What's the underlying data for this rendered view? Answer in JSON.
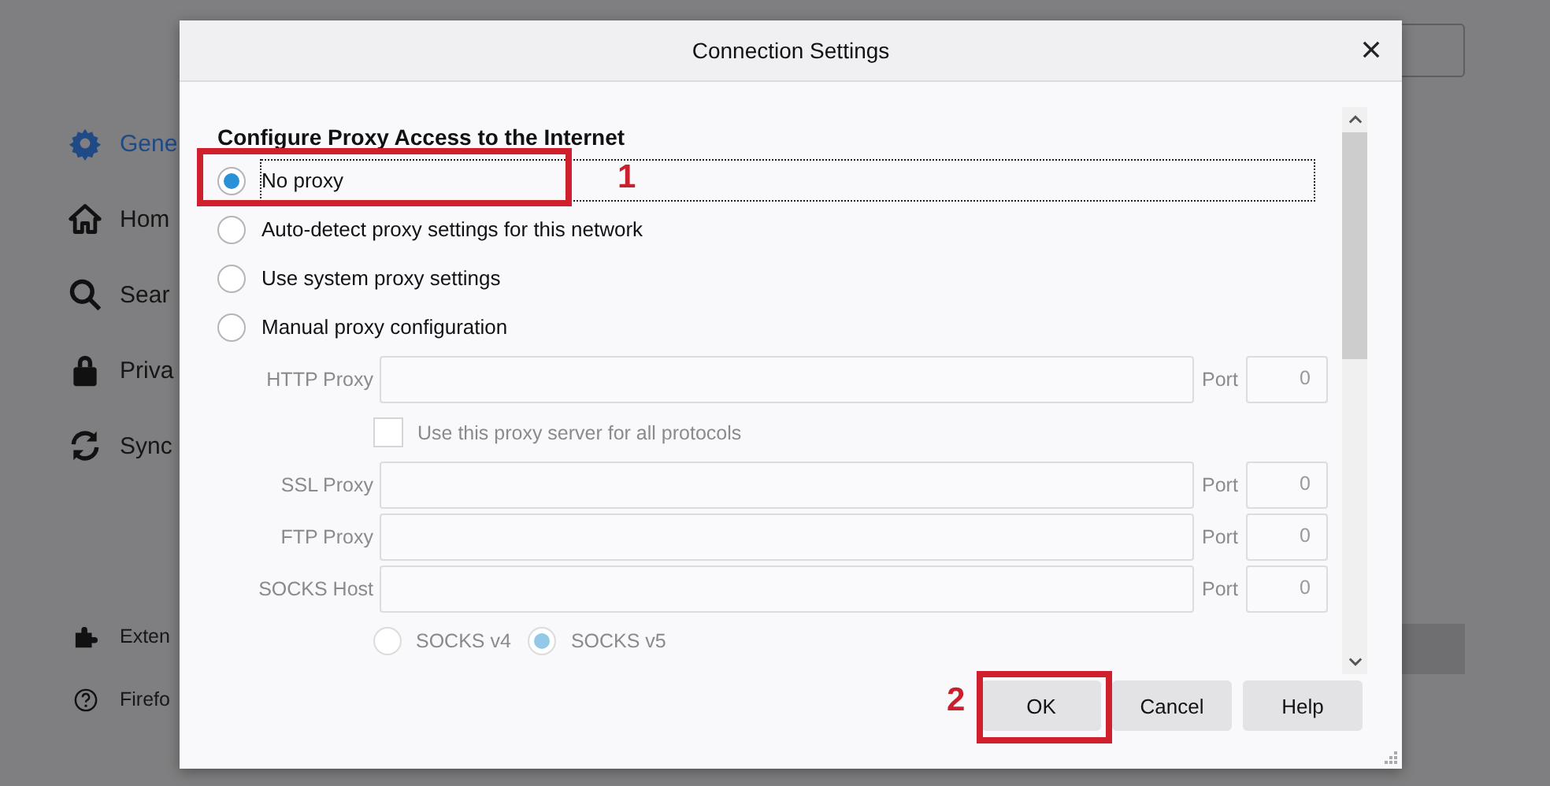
{
  "sidebar": {
    "items": [
      {
        "label": "Gene",
        "selected": true
      },
      {
        "label": "Hom",
        "selected": false
      },
      {
        "label": "Sear",
        "selected": false
      },
      {
        "label": "Priva",
        "selected": false
      },
      {
        "label": "Sync",
        "selected": false
      }
    ],
    "footer_items": [
      {
        "label": "Exten"
      },
      {
        "label": "Firefo"
      }
    ]
  },
  "dialog": {
    "title": "Connection Settings",
    "heading": "Configure Proxy Access to the Internet",
    "options": [
      {
        "label": "No proxy",
        "selected": true,
        "focused": true,
        "annotation": "1"
      },
      {
        "label": "Auto-detect proxy settings for this network",
        "selected": false,
        "focused": false
      },
      {
        "label": "Use system proxy settings",
        "selected": false,
        "focused": false
      },
      {
        "label": "Manual proxy configuration",
        "selected": false,
        "focused": false
      }
    ],
    "manual": [
      {
        "kind": "field",
        "label": "HTTP Proxy",
        "port_label": "Port",
        "port": "0",
        "disabled": true
      },
      {
        "kind": "checkbox",
        "label": "Use this proxy server for all protocols",
        "checked": false,
        "disabled": true
      },
      {
        "kind": "field",
        "label": "SSL Proxy",
        "port_label": "Port",
        "port": "0",
        "disabled": true
      },
      {
        "kind": "field",
        "label": "FTP Proxy",
        "port_label": "Port",
        "port": "0",
        "disabled": true
      },
      {
        "kind": "field",
        "label": "SOCKS Host",
        "port_label": "Port",
        "port": "0",
        "disabled": true
      }
    ],
    "socks_versions": [
      {
        "label": "SOCKS v4",
        "selected": false,
        "disabled": true
      },
      {
        "label": "SOCKS v5",
        "selected": true,
        "disabled": true
      }
    ],
    "buttons": [
      {
        "label": "OK",
        "annotation": "2"
      },
      {
        "label": "Cancel"
      },
      {
        "label": "Help"
      }
    ]
  }
}
